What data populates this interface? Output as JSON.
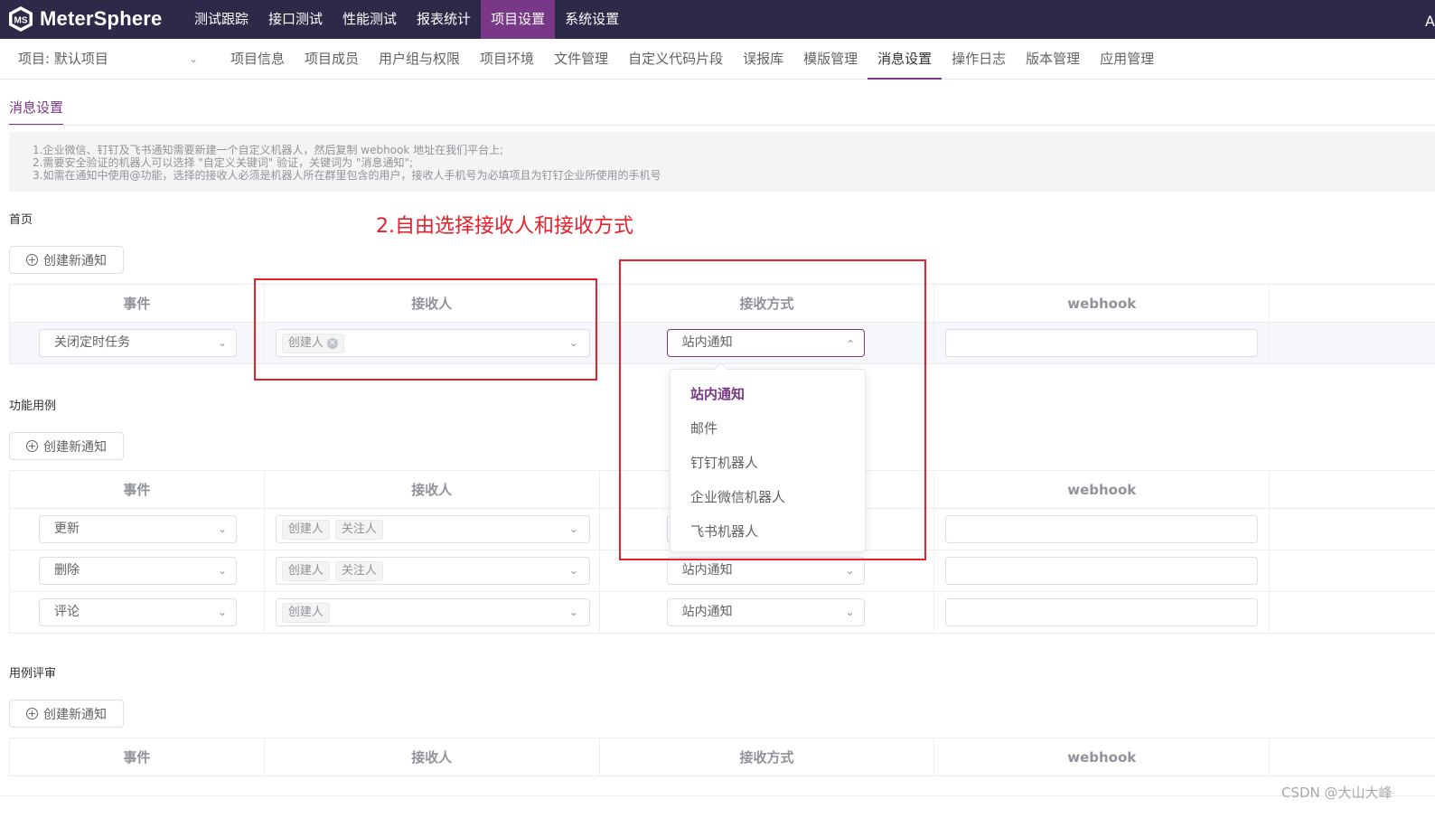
{
  "brand": {
    "name": "MeterSphere",
    "accent": "#783887",
    "topbar_bg": "#2c2a48"
  },
  "topnav": [
    {
      "label": "测试跟踪",
      "active": false
    },
    {
      "label": "接口测试",
      "active": false
    },
    {
      "label": "性能测试",
      "active": false
    },
    {
      "label": "报表统计",
      "active": false
    },
    {
      "label": "项目设置",
      "active": true
    },
    {
      "label": "系统设置",
      "active": false
    }
  ],
  "topbar_edge": "A",
  "project": {
    "label": "项目: 默认项目"
  },
  "subnav": [
    {
      "label": "项目信息"
    },
    {
      "label": "项目成员"
    },
    {
      "label": "用户组与权限"
    },
    {
      "label": "项目环境"
    },
    {
      "label": "文件管理"
    },
    {
      "label": "自定义代码片段"
    },
    {
      "label": "误报库"
    },
    {
      "label": "模版管理"
    },
    {
      "label": "消息设置",
      "active": true
    },
    {
      "label": "操作日志"
    },
    {
      "label": "版本管理"
    },
    {
      "label": "应用管理"
    }
  ],
  "page_tab": "消息设置",
  "notice": [
    "1.企业微信、钉钉及飞书通知需要新建一个自定义机器人，然后复制 webhook 地址在我们平台上;",
    "2.需要安全验证的机器人可以选择 \"自定义关键词\" 验证，关键词为 \"消息通知\";",
    "3.如需在通知中使用@功能，选择的接收人必须是机器人所在群里包含的用户，接收人手机号为必填项且为钉钉企业所使用的手机号"
  ],
  "create_label": "创建新通知",
  "columns": {
    "event": "事件",
    "receiver": "接收人",
    "method": "接收方式",
    "webhook": "webhook"
  },
  "sections": [
    {
      "title": "首页",
      "rows": [
        {
          "event": "关闭定时任务",
          "receivers": [
            "创建人"
          ],
          "method": "站内通知"
        }
      ]
    },
    {
      "title": "功能用例",
      "rows": [
        {
          "event": "更新",
          "receivers": [
            "创建人",
            "关注人"
          ],
          "method": ""
        },
        {
          "event": "删除",
          "receivers": [
            "创建人",
            "关注人"
          ],
          "method": "站内通知"
        },
        {
          "event": "评论",
          "receivers": [
            "创建人"
          ],
          "method": "站内通知"
        }
      ]
    },
    {
      "title": "用例评审",
      "rows": []
    }
  ],
  "dropdown": {
    "options": [
      "站内通知",
      "邮件",
      "钉钉机器人",
      "企业微信机器人",
      "飞书机器人"
    ],
    "selected": "站内通知"
  },
  "annotation": {
    "text": "2.自由选择接收人和接收方式",
    "color": "#e8202a"
  },
  "watermark": "CSDN @大山大峰"
}
